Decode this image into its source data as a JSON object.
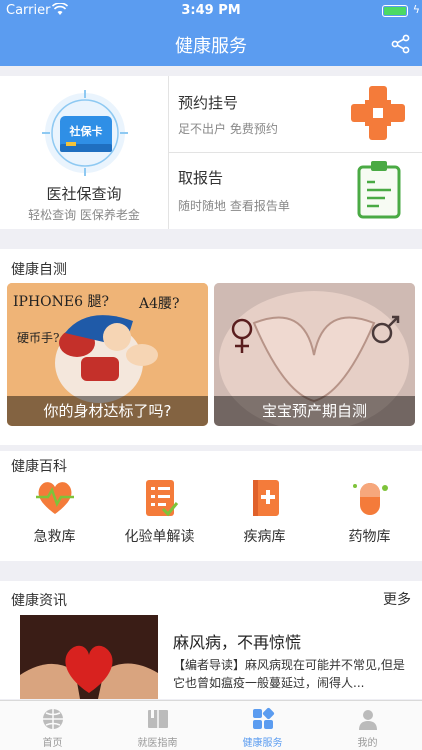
{
  "status_bar": {
    "carrier": "Carrier",
    "time": "3:49 PM"
  },
  "nav": {
    "title": "健康服务",
    "share_icon": "share-icon"
  },
  "top_services": {
    "insurance": {
      "card_label": "社保卡",
      "title": "医社保查询",
      "subtitle": "轻松查询 医保养老金"
    },
    "appointment": {
      "title": "预约挂号",
      "subtitle": "足不出户 免费预约"
    },
    "report": {
      "title": "取报告",
      "subtitle": "随时随地 查看报告单"
    }
  },
  "self_test": {
    "label": "健康自测",
    "items": [
      {
        "caption": "你的身材达标了吗?",
        "doodle_a": "IPHONE6 腿?",
        "doodle_b": "A4腰?",
        "doodle_c": "硬币手?"
      },
      {
        "caption": "宝宝预产期自测"
      }
    ]
  },
  "wiki": {
    "label": "健康百科",
    "items": [
      {
        "label": "急救库",
        "icon": "heart-pulse-icon"
      },
      {
        "label": "化验单解读",
        "icon": "checklist-icon"
      },
      {
        "label": "疾病库",
        "icon": "book-plus-icon"
      },
      {
        "label": "药物库",
        "icon": "pill-icon"
      }
    ]
  },
  "news": {
    "label": "健康资讯",
    "more": "更多",
    "article": {
      "title": "麻风病，不再惊慌",
      "desc": "【编者导读】麻风病现在可能并不常见,但是它也曾如瘟疫一般蔓延过，闹得人..."
    }
  },
  "tabs": [
    {
      "label": "首页",
      "active": false
    },
    {
      "label": "就医指南",
      "active": false
    },
    {
      "label": "健康服务",
      "active": true
    },
    {
      "label": "我的",
      "active": false
    }
  ],
  "colors": {
    "primary": "#5b9cf0",
    "accent_orange": "#f47b3a",
    "accent_green": "#4aaa44"
  }
}
